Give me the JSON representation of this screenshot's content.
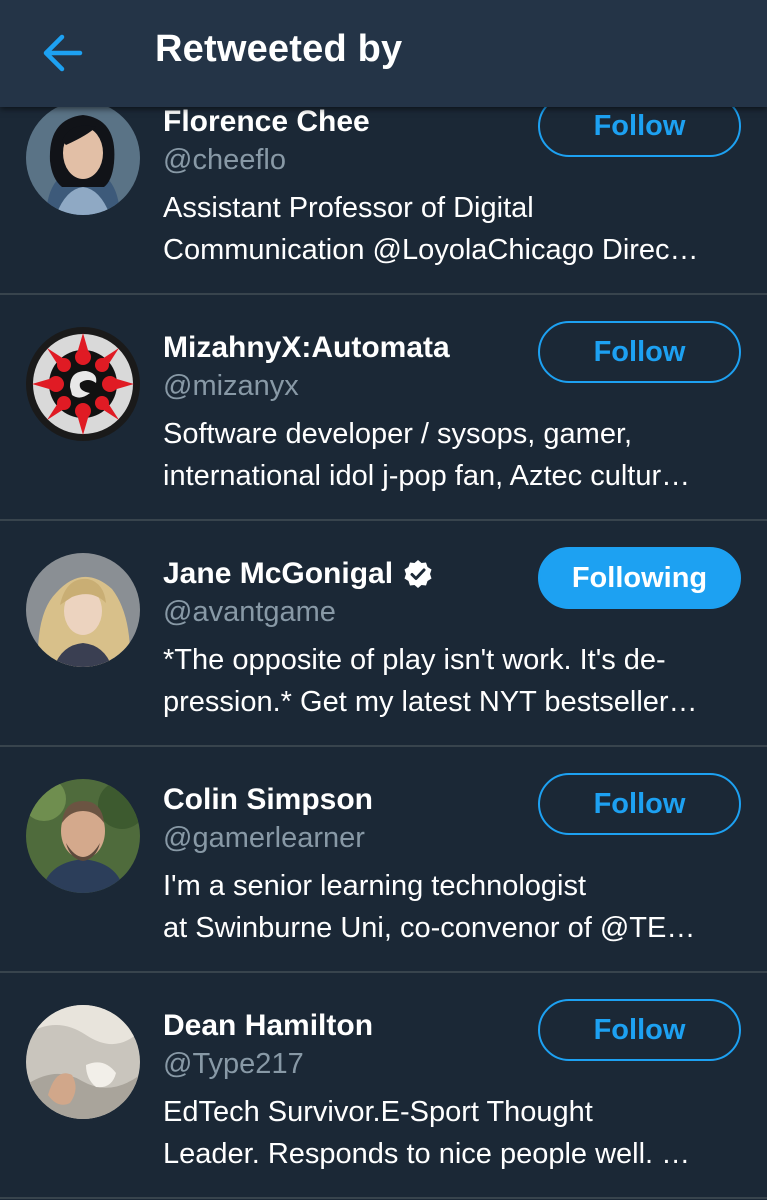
{
  "header": {
    "title": "Retweeted by",
    "back_icon": "arrow-left-icon",
    "accent": "#1da1f2"
  },
  "users": [
    {
      "name": "Florence Chee",
      "handle": "@cheeflo",
      "bio_line1": "Assistant Professor of Digital",
      "bio_line2": "Communication @LoyolaChicago Direc…",
      "button": "Follow",
      "following": false,
      "verified": false
    },
    {
      "name": "MizahnyX:Automata",
      "handle": "@mizanyx",
      "bio_line1": "Software developer / sysops, gamer,",
      "bio_line2": "international idol j-pop fan, Aztec cultur…",
      "button": "Follow",
      "following": false,
      "verified": false
    },
    {
      "name": "Jane McGonigal",
      "handle": "@avantgame",
      "bio_line1": "*The opposite of play isn't work. It's de-",
      "bio_line2": "pression.* Get my latest NYT bestseller…",
      "button": "Following",
      "following": true,
      "verified": true
    },
    {
      "name": "Colin Simpson",
      "handle": "@gamerlearner",
      "bio_line1": "I'm a senior learning technologist",
      "bio_line2": "at Swinburne Uni, co-convenor of @TE…",
      "button": "Follow",
      "following": false,
      "verified": false
    },
    {
      "name": "Dean Hamilton",
      "handle": "@Type217",
      "bio_line1": "EdTech Survivor.E-Sport Thought",
      "bio_line2": "Leader. Responds to nice people well. …",
      "button": "Follow",
      "following": false,
      "verified": false
    }
  ]
}
